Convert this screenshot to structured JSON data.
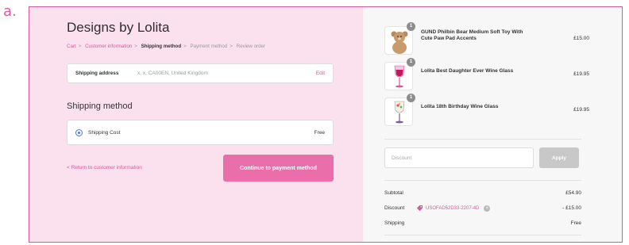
{
  "figure_label": "a.",
  "store": {
    "title": "Designs by Lolita"
  },
  "breadcrumb": {
    "items": [
      {
        "label": "Cart",
        "state": "link"
      },
      {
        "label": "Customer information",
        "state": "link"
      },
      {
        "label": "Shipping method",
        "state": "current"
      },
      {
        "label": "Payment method",
        "state": "muted"
      },
      {
        "label": "Review order",
        "state": "muted"
      }
    ],
    "separator": ">"
  },
  "shipping_address": {
    "label": "Shipping address",
    "value": "x, x, CA00EN, United Kingdom",
    "edit_label": "Edit"
  },
  "shipping_method": {
    "section_title": "Shipping method",
    "option_label": "Shipping Cost",
    "option_price": "Free",
    "selected": true
  },
  "actions": {
    "return_label": "< Return to customer information",
    "continue_label": "Continue to payment method"
  },
  "order": {
    "items": [
      {
        "quantity": "1",
        "name": "GUND Philbin Bear Medium Soft Toy With Cute Paw Pad Accents",
        "price": "£15.00",
        "thumb_icon": "teddy-bear-icon"
      },
      {
        "quantity": "1",
        "name": "Lolita Best Daughter Ever Wine Glass",
        "price": "£19.95",
        "thumb_icon": "wine-glass-icon"
      },
      {
        "quantity": "1",
        "name": "Lolita 18th Birthday Wine Glass",
        "price": "£19.95",
        "thumb_icon": "wine-glass-icon"
      }
    ],
    "discount": {
      "placeholder": "Discount",
      "apply_label": "Apply"
    },
    "summary": {
      "subtotal_label": "Subtotal",
      "subtotal_value": "£54.90",
      "discount_label": "Discount",
      "discount_code": "USOFAD52D33-2207-4D",
      "discount_value": "- £15.00",
      "shipping_label": "Shipping",
      "shipping_value": "Free"
    }
  },
  "colors": {
    "accent": "#d45a9c",
    "button": "#ea6ea9",
    "left_panel": "#fbe1ee",
    "right_panel": "#f7f7f7"
  }
}
